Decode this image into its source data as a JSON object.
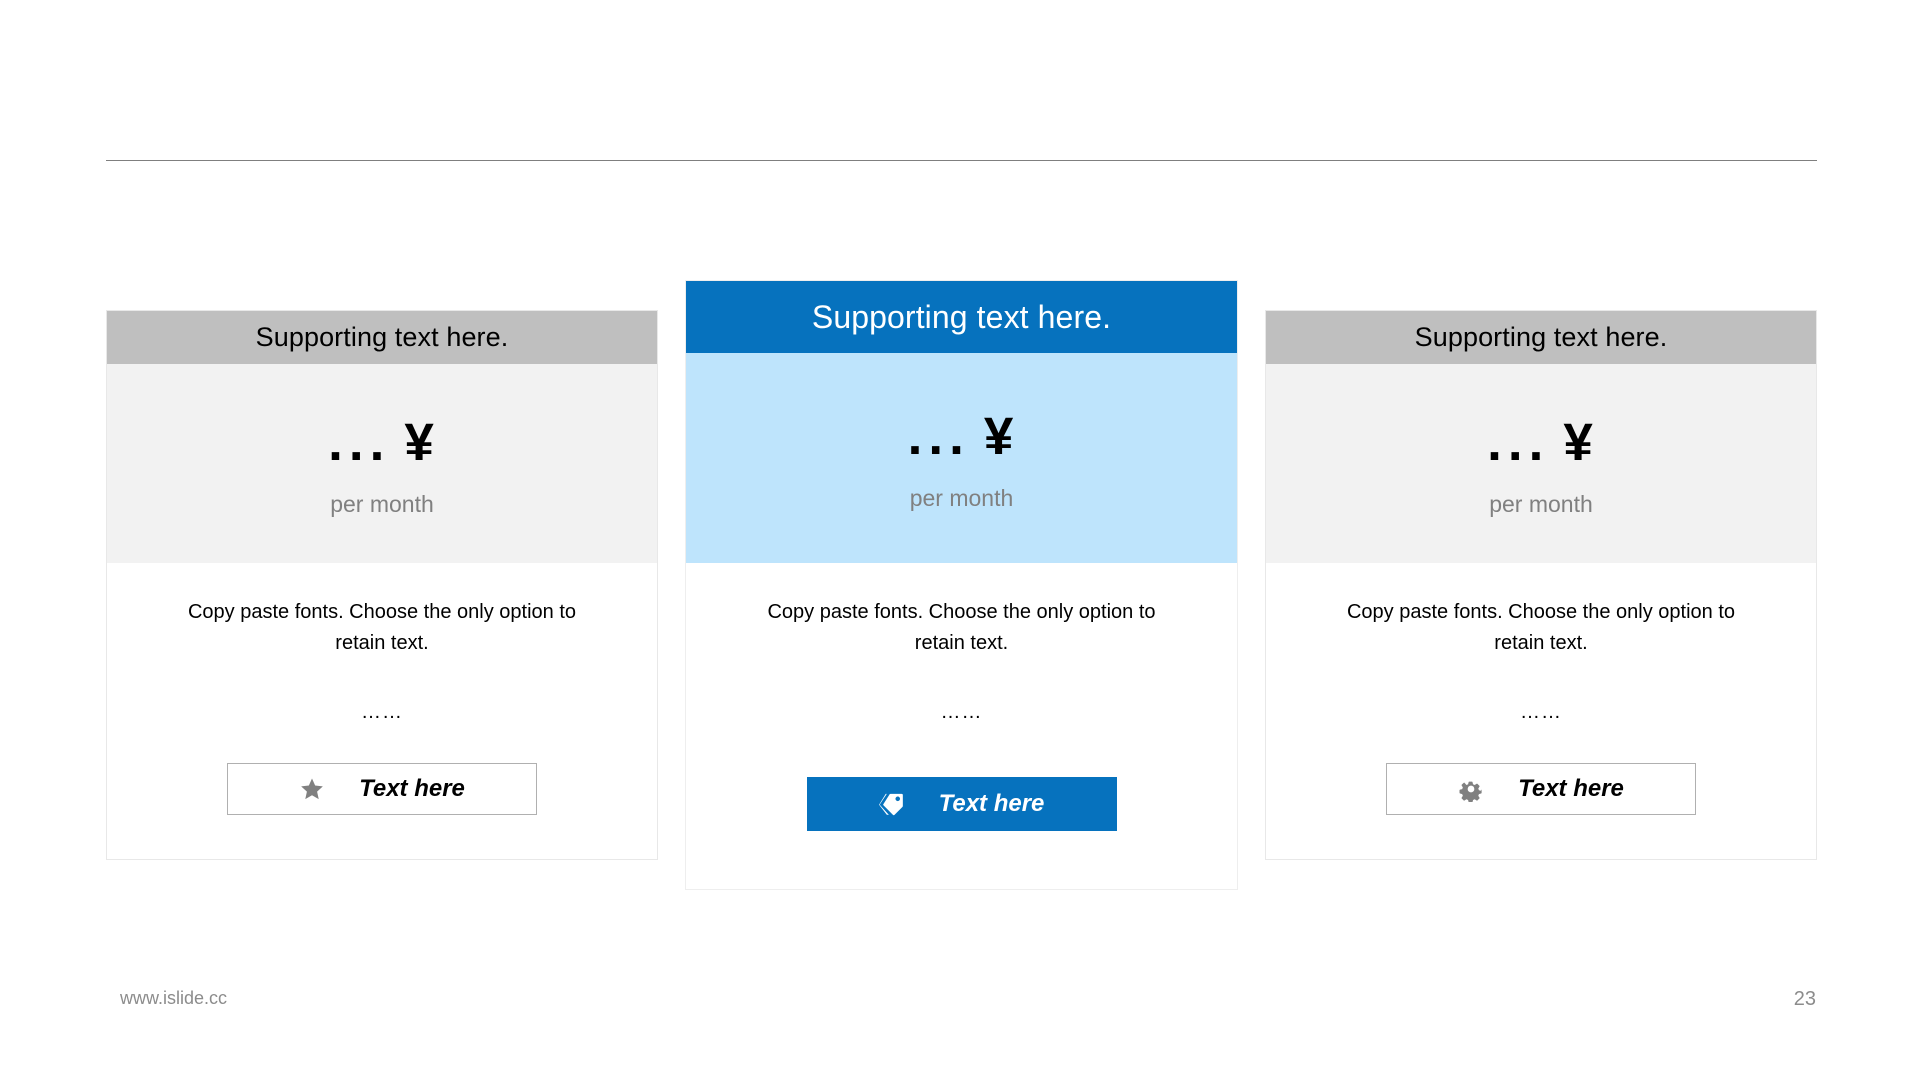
{
  "slide": {
    "title": "",
    "divider_color": "#7f7f7f",
    "background": "#ffffff"
  },
  "theme": {
    "accent_blue": "#0672be",
    "accent_blue_light": "#bee4fc",
    "neutral_gray": "#bfbfbf",
    "neutral_gray_light": "#f2f2f2",
    "muted_text": "#808080"
  },
  "cards": [
    {
      "header": "Supporting text here.",
      "price_dots": "...",
      "price_currency": "¥",
      "price_period": "per month",
      "body": "Copy paste fonts. Choose the only option to retain text.",
      "ellipsis": "……",
      "cta_label": "Text here",
      "cta_icon": "star-icon",
      "featured": false
    },
    {
      "header": "Supporting text here.",
      "price_dots": "...",
      "price_currency": "¥",
      "price_period": "per month",
      "body": "Copy paste fonts. Choose the only option to retain text.",
      "ellipsis": "……",
      "cta_label": "Text here",
      "cta_icon": "tag-icon",
      "featured": true
    },
    {
      "header": "Supporting text here.",
      "price_dots": "...",
      "price_currency": "¥",
      "price_period": "per month",
      "body": "Copy paste fonts. Choose the only option to retain text.",
      "ellipsis": "……",
      "cta_label": "Text here",
      "cta_icon": "gear-icon",
      "featured": false
    }
  ],
  "footer": {
    "url": "www.islide.cc",
    "page_number": "23"
  }
}
